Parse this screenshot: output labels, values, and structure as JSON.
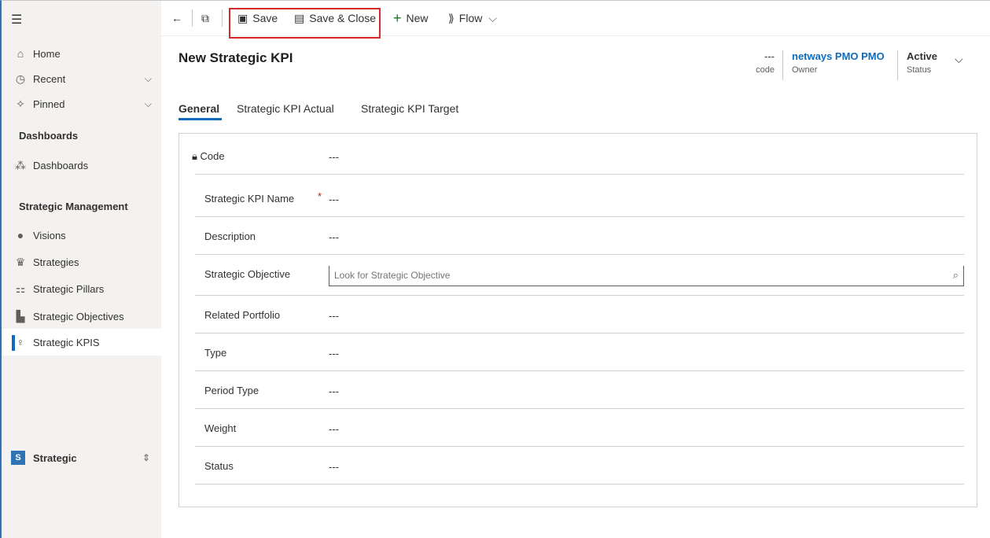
{
  "sidebar": {
    "home": "Home",
    "recent": "Recent",
    "pinned": "Pinned",
    "dashboards_header": "Dashboards",
    "dashboards": "Dashboards",
    "strategic_header": "Strategic Management",
    "items": [
      {
        "label": "Visions",
        "icon": "eye-icon"
      },
      {
        "label": "Strategies",
        "icon": "trophy-icon"
      },
      {
        "label": "Strategic Pillars",
        "icon": "pillars-icon"
      },
      {
        "label": "Strategic Objectives",
        "icon": "objectives-icon"
      },
      {
        "label": "Strategic KPIS",
        "icon": "bulb-icon"
      }
    ],
    "area_badge": "S",
    "area_label": "Strategic"
  },
  "toolbar": {
    "save": "Save",
    "save_close": "Save & Close",
    "new": "New",
    "flow": "Flow"
  },
  "header": {
    "title": "New Strategic KPI",
    "code_value": "---",
    "code_label": "code",
    "owner_value": "netways PMO PMO",
    "owner_label": "Owner",
    "status_value": "Active",
    "status_label": "Status"
  },
  "tabs": [
    "General",
    "Strategic KPI Actual",
    "Strategic KPI Target"
  ],
  "form": {
    "code_label": "Code",
    "code_value": "---",
    "name_label": "Strategic KPI Name",
    "name_value": "---",
    "desc_label": "Description",
    "desc_value": "---",
    "objective_label": "Strategic Objective",
    "objective_placeholder": "Look for Strategic Objective",
    "portfolio_label": "Related Portfolio",
    "portfolio_value": "---",
    "type_label": "Type",
    "type_value": "---",
    "period_label": "Period Type",
    "period_value": "---",
    "weight_label": "Weight",
    "weight_value": "---",
    "status_label": "Status",
    "status_value": "---"
  },
  "colors": {
    "accent": "#0f6cbd",
    "highlight_box": "#d62828",
    "owner_link": "#0f6cbd"
  }
}
